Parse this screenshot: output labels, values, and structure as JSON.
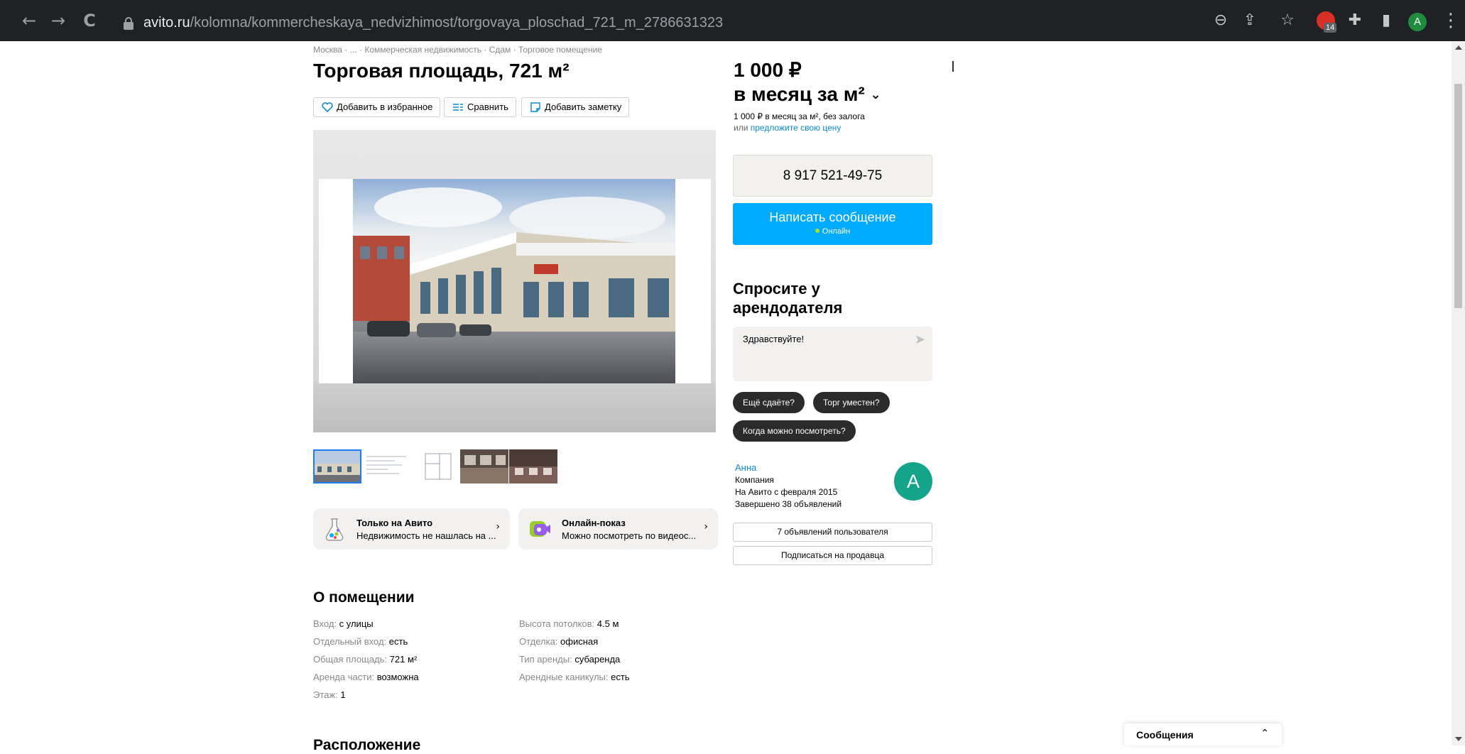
{
  "browser": {
    "nav": {
      "back_icon": "←",
      "forward_icon": "→",
      "reload_icon": "C"
    },
    "url_host": "avito.ru",
    "url_path": "/kolomna/kommercheskaya_nedvizhimost/torgovaya_ploschad_721_m_2786631323",
    "right_icons": {
      "zoom": "⊖",
      "share": "⇪",
      "star": "☆",
      "extensions": "✚",
      "sidepanel": "▮"
    },
    "extension_badge_count": "14",
    "profile_letter": "A",
    "menu": "⋮"
  },
  "breadcrumb": [
    "Москва",
    "...",
    "Коммерческая недвижимость",
    "Сдам",
    "Торговое помещение"
  ],
  "breadcrumb_separator": " · ",
  "title": "Торговая площадь, 721 м²",
  "actions": {
    "favorite": "Добавить в избранное",
    "compare": "Сравнить",
    "note": "Добавить заметку"
  },
  "promos": [
    {
      "title": "Только на Авито",
      "text": "Недвижимость не нашлась на ...",
      "chevron": "›"
    },
    {
      "title": "Онлайн-показ",
      "text": "Можно посмотреть по видеос...",
      "chevron": "›"
    }
  ],
  "about": {
    "title": "О помещении",
    "params_left": [
      {
        "label": "Вход: ",
        "value": "с улицы"
      },
      {
        "label": "Отдельный вход: ",
        "value": "есть"
      },
      {
        "label": "Общая площадь: ",
        "value": "721 м²"
      },
      {
        "label": "Аренда части: ",
        "value": "возможна"
      },
      {
        "label": "Этаж: ",
        "value": "1"
      }
    ],
    "params_right": [
      {
        "label": "Высота потолков: ",
        "value": "4.5 м"
      },
      {
        "label": "Отделка: ",
        "value": "офисная"
      },
      {
        "label": "Тип аренды: ",
        "value": "субаренда"
      },
      {
        "label": "Арендные каникулы: ",
        "value": "есть"
      }
    ]
  },
  "location_title": "Расположение",
  "price": {
    "amount": "1 000 ₽",
    "unit": "в месяц за м²",
    "chevron": "⌄",
    "note": "1 000 ₽ в месяц за м², без залога",
    "offer_prefix": "или ",
    "offer_link": "предложите свою цену"
  },
  "phone": "8 917 521-49-75",
  "message_button": {
    "label": "Написать сообщение",
    "status": "Онлайн"
  },
  "ask": {
    "title": "Спросите у арендодателя",
    "message": "Здравствуйте!",
    "send_icon": "➤",
    "chips": [
      "Ещё сдаёте?",
      "Торг уместен?",
      "Когда можно посмотреть?"
    ]
  },
  "seller": {
    "name": "Анна",
    "type": "Компания",
    "since": "На Авито с февраля 2015",
    "completed": "Завершено 38 объявлений",
    "avatar_letter": "A",
    "listings_button": "7 объявлений пользователя",
    "subscribe_button": "Подписаться на продавца"
  },
  "messenger": {
    "label": "Сообщения",
    "toggle_icon": "⌃"
  },
  "colors": {
    "accent": "#00aaff",
    "link": "#0a8ad6",
    "avatar": "#14a48c",
    "chip": "#2b2b2b"
  }
}
